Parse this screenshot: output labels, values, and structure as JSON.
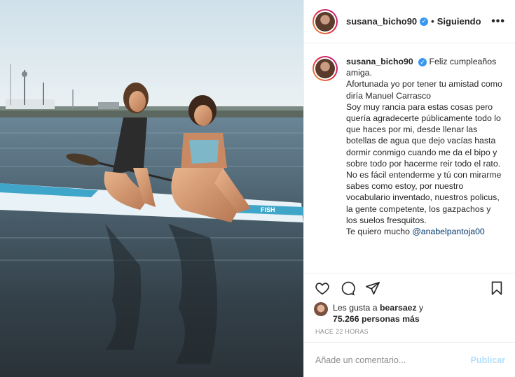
{
  "post": {
    "username": "susana_bicho90",
    "verified_glyph": "✓",
    "separator": "•",
    "follow_status": "Siguiendo",
    "more_glyph": "•••"
  },
  "caption": {
    "username": "susana_bicho90",
    "lines": [
      "Feliz cumpleaños amiga.",
      "Afortunada yo por tener tu amistad como diría Manuel Carrasco",
      "Soy muy rancia para estas cosas pero quería agradecerte públicamente todo lo que haces por mi, desde llenar las botellas de agua que dejo vacías hasta dormir conmigo cuando me da el bipo y sobre todo por hacerme reir todo el rato.",
      "No es fácil entenderme y tú con mirarme sabes como estoy, por nuestro vocabulario inventado, nuestros policus, la gente competente, los gazpachos y los suelos fresquitos."
    ],
    "closing": "Te quiero mucho ",
    "mention": "@anabelpantoja00"
  },
  "likes": {
    "prefix": "Les gusta a ",
    "user": "bearsaez",
    "joiner": " y",
    "count_text": "75.266 personas más"
  },
  "timestamp": "HACE 22 HORAS",
  "comment_box": {
    "placeholder": "Añade un comentario...",
    "publish_label": "Publicar"
  },
  "icons": [
    "heart-icon",
    "comment-icon",
    "share-icon",
    "bookmark-icon"
  ],
  "colors": {
    "link": "#00376b",
    "verified": "#3897f0",
    "publish_disabled": "#b2dffc",
    "muted": "#8e8e8e"
  }
}
